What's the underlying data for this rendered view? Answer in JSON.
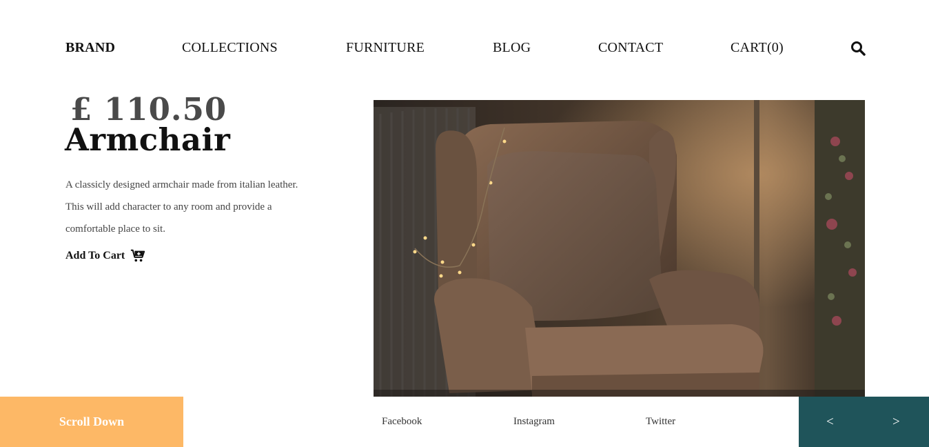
{
  "nav": {
    "brand": "BRAND",
    "items": [
      "COLLECTIONS",
      "FURNITURE",
      "BLOG",
      "CONTACT",
      "CART(0)"
    ],
    "search_icon": "search-icon"
  },
  "product": {
    "price": "£ 110.50",
    "name": "Armchair",
    "description_lines": [
      "A classicly designed armchair made from italian leather.",
      "This will add character to any room and provide a",
      "comfortable place to sit."
    ],
    "add_to_cart_label": "Add To Cart",
    "cart_icon": "cart-plus-icon"
  },
  "footer": {
    "scroll_down": "Scroll Down",
    "social": [
      "Facebook",
      "Instagram",
      "Twitter"
    ],
    "prev": "<",
    "next": ">"
  },
  "colors": {
    "accent_orange": "#fdb866",
    "accent_teal": "#1f545a",
    "price_gray": "#4a4a4a"
  }
}
